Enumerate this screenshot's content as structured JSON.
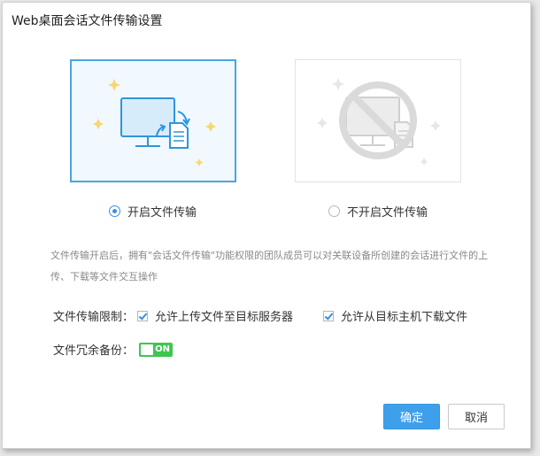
{
  "dialog": {
    "title": "Web桌面会话文件传输设置"
  },
  "modes": {
    "enable_label": "开启文件传输",
    "disable_label": "不开启文件传输",
    "selected": "enable"
  },
  "description": "文件传输开启后，拥有\"会话文件传输\"功能权限的团队成员可以对关联设备所创建的会话进行文件的上传、下载等文件交互操作",
  "restrictions": {
    "label": "文件传输限制：",
    "upload_label": "允许上传文件至目标服务器",
    "upload_checked": true,
    "download_label": "允许从目标主机下载文件",
    "download_checked": true
  },
  "backup": {
    "label": "文件冗余备份：",
    "toggle_text": "ON",
    "enabled": true
  },
  "buttons": {
    "ok_label": "确定",
    "cancel_label": "取消"
  },
  "colors": {
    "accent": "#3ea0ea",
    "selected_border": "#4aa4e0",
    "toggle_on": "#3ec64f",
    "monitor_fill": "#d7ecfb",
    "monitor_stroke": "#2f95dd",
    "sparkle": "#f7d774"
  },
  "icons": {
    "enable_card": "monitor-file-transfer-icon",
    "disable_card": "monitor-prohibited-icon"
  }
}
